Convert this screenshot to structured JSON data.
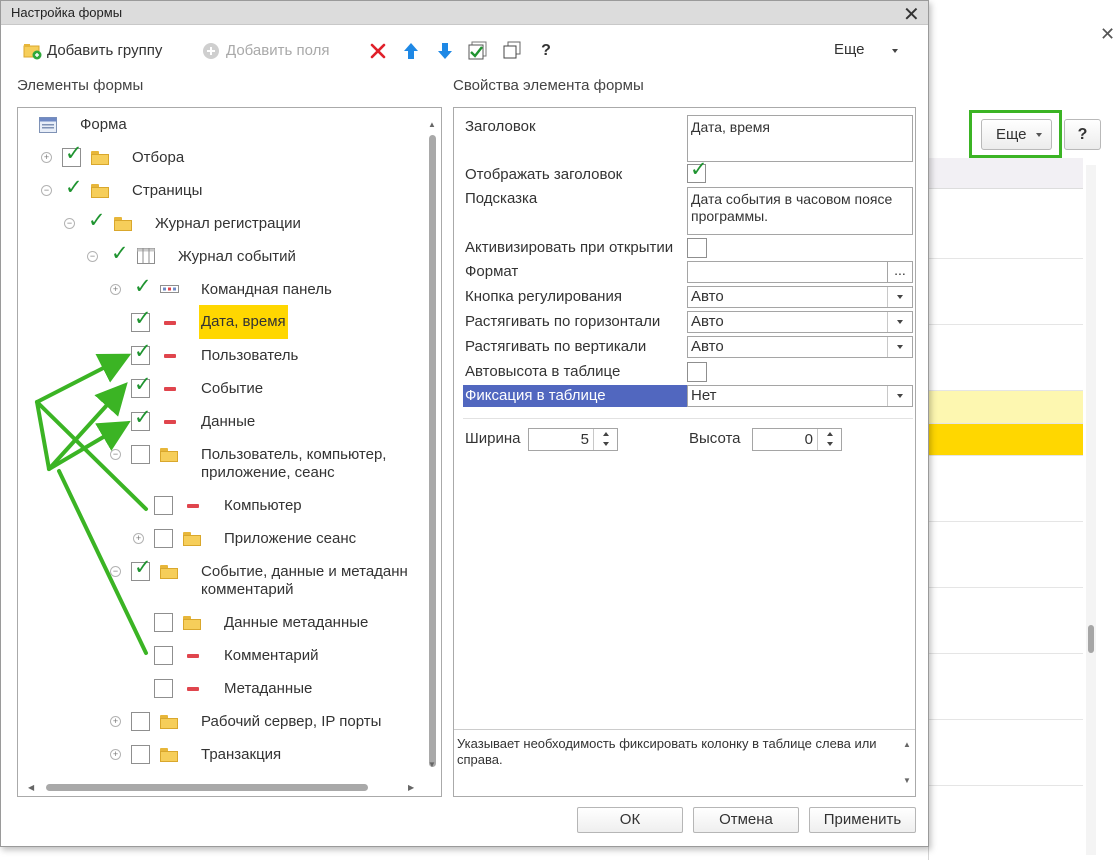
{
  "dialog": {
    "title": "Настройка формы",
    "close": "✕"
  },
  "toolbar": {
    "add_group": "Добавить группу",
    "add_fields": "Добавить поля",
    "help": "?",
    "more": "Еще"
  },
  "left_panel": {
    "title": "Элементы формы"
  },
  "right_panel": {
    "title": "Свойства элемента формы"
  },
  "tree": {
    "root": "Форма",
    "items": [
      {
        "label": "Отбора",
        "checked": true,
        "icon": "folder-icon"
      },
      {
        "label": "Страницы",
        "checked": true,
        "icon": "folder-icon"
      },
      {
        "label": "Журнал регистрации",
        "checked": true,
        "icon": "folder-icon"
      },
      {
        "label": "Журнал событий",
        "checked": true,
        "icon": "table-icon"
      },
      {
        "label": "Командная панель",
        "checked": true,
        "icon": "command-bar-icon"
      },
      {
        "label": "Дата, время",
        "checked": true,
        "icon": "field-icon",
        "highlighted": true
      },
      {
        "label": "Пользователь",
        "checked": true,
        "icon": "field-icon"
      },
      {
        "label": "Событие",
        "checked": true,
        "icon": "field-icon"
      },
      {
        "label": "Данные",
        "checked": true,
        "icon": "field-icon"
      },
      {
        "label_line1": "Пользователь, компьютер,",
        "label_line2": "приложение, сеанс",
        "checked": false,
        "icon": "folder-icon"
      },
      {
        "label": "Компьютер",
        "checked": false,
        "icon": "field-icon"
      },
      {
        "label": "Приложение сеанс",
        "checked": false,
        "icon": "folder-icon"
      },
      {
        "label_line1": "Событие, данные и метаданн",
        "label_line2": "комментарий",
        "checked": true,
        "icon": "folder-icon"
      },
      {
        "label": "Данные метаданные",
        "checked": false,
        "icon": "folder-icon"
      },
      {
        "label": "Комментарий",
        "checked": false,
        "icon": "field-icon"
      },
      {
        "label": "Метаданные",
        "checked": false,
        "icon": "field-icon"
      },
      {
        "label": "Рабочий сервер, IP порты",
        "checked": false,
        "icon": "folder-icon"
      },
      {
        "label": "Транзакция",
        "checked": false,
        "icon": "folder-icon"
      }
    ]
  },
  "properties": {
    "title_label": "Заголовок",
    "title_value": "Дата, время",
    "show_title_label": "Отображать заголовок",
    "show_title_checked": true,
    "hint_label": "Подсказка",
    "hint_value": "Дата события в часовом поясе программы.",
    "activate_label": "Активизировать при открытии",
    "activate_checked": false,
    "format_label": "Формат",
    "format_value": "",
    "format_button": "...",
    "adjust_button_label": "Кнопка регулирования",
    "adjust_button_value": "Авто",
    "stretch_h_label": "Растягивать по горизонтали",
    "stretch_h_value": "Авто",
    "stretch_v_label": "Растягивать по вертикали",
    "stretch_v_value": "Авто",
    "autoheight_label": "Автовысота в таблице",
    "autoheight_checked": false,
    "fix_label": "Фиксация в таблице",
    "fix_value": "Нет",
    "width_label": "Ширина",
    "width_value": "5",
    "height_label": "Высота",
    "height_value": "0",
    "description": "Указывает необходимость фиксировать колонку в таблице слева или справа."
  },
  "footer": {
    "ok": "ОК",
    "cancel": "Отмена",
    "apply": "Применить"
  },
  "background_window": {
    "close": "✕",
    "more": "Еще",
    "help": "?"
  },
  "colors": {
    "highlight": "#ffd700",
    "selected_row": "#5167bf",
    "check": "#1f9430",
    "annotation": "#3bb424",
    "delete": "#e0202a",
    "arrow_blue": "#1e88e5"
  }
}
